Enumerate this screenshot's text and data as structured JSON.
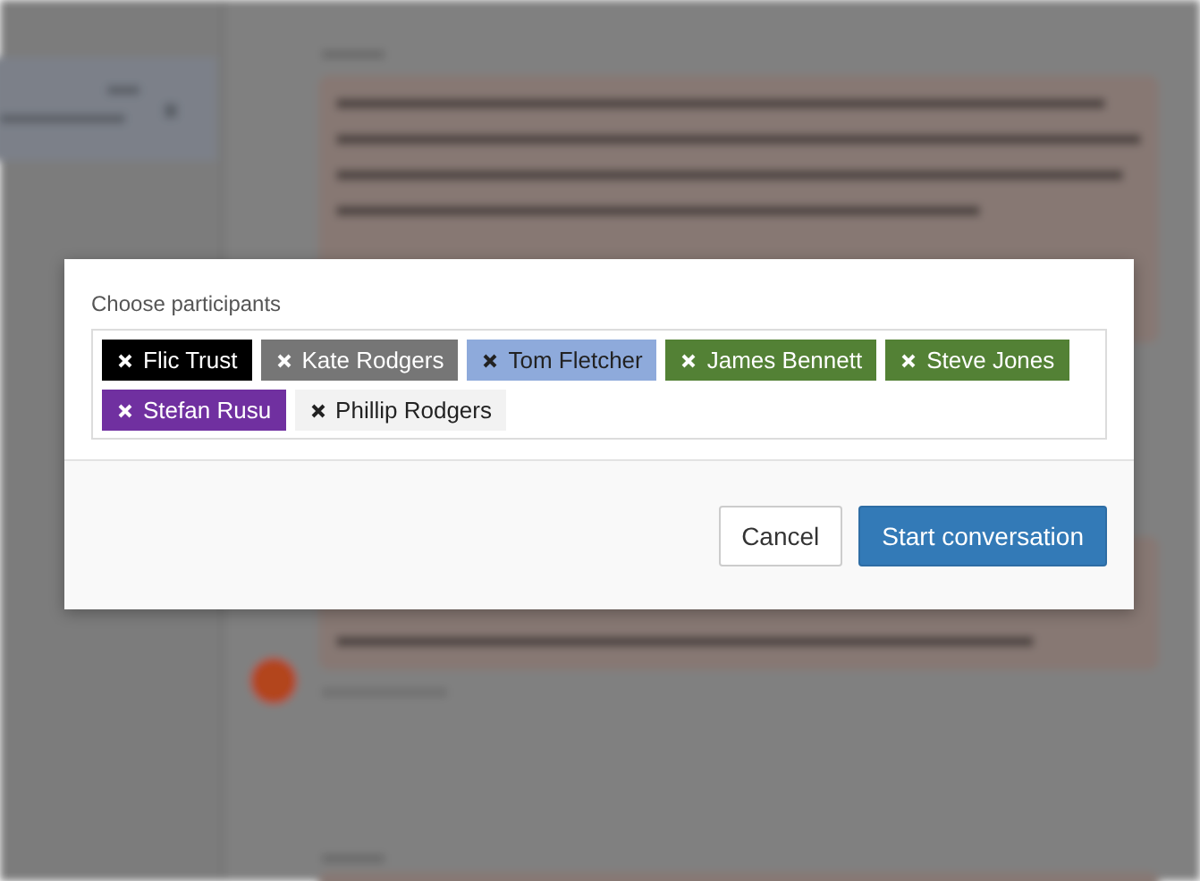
{
  "dialog": {
    "label": "Choose participants",
    "participants": [
      {
        "name": "Flic Trust",
        "color": "#000000"
      },
      {
        "name": "Kate Rodgers",
        "color": "#767676"
      },
      {
        "name": "Tom Fletcher",
        "color": "#8eaadb"
      },
      {
        "name": "James Bennett",
        "color": "#538135"
      },
      {
        "name": "Steve Jones",
        "color": "#538135"
      },
      {
        "name": "Stefan Rusu",
        "color": "#7030a0"
      },
      {
        "name": "Phillip Rodgers",
        "color": "#f2f2f2"
      }
    ],
    "buttons": [
      {
        "label": "Cancel",
        "kind": "secondary"
      },
      {
        "label": "Start conversation",
        "kind": "primary"
      }
    ]
  }
}
